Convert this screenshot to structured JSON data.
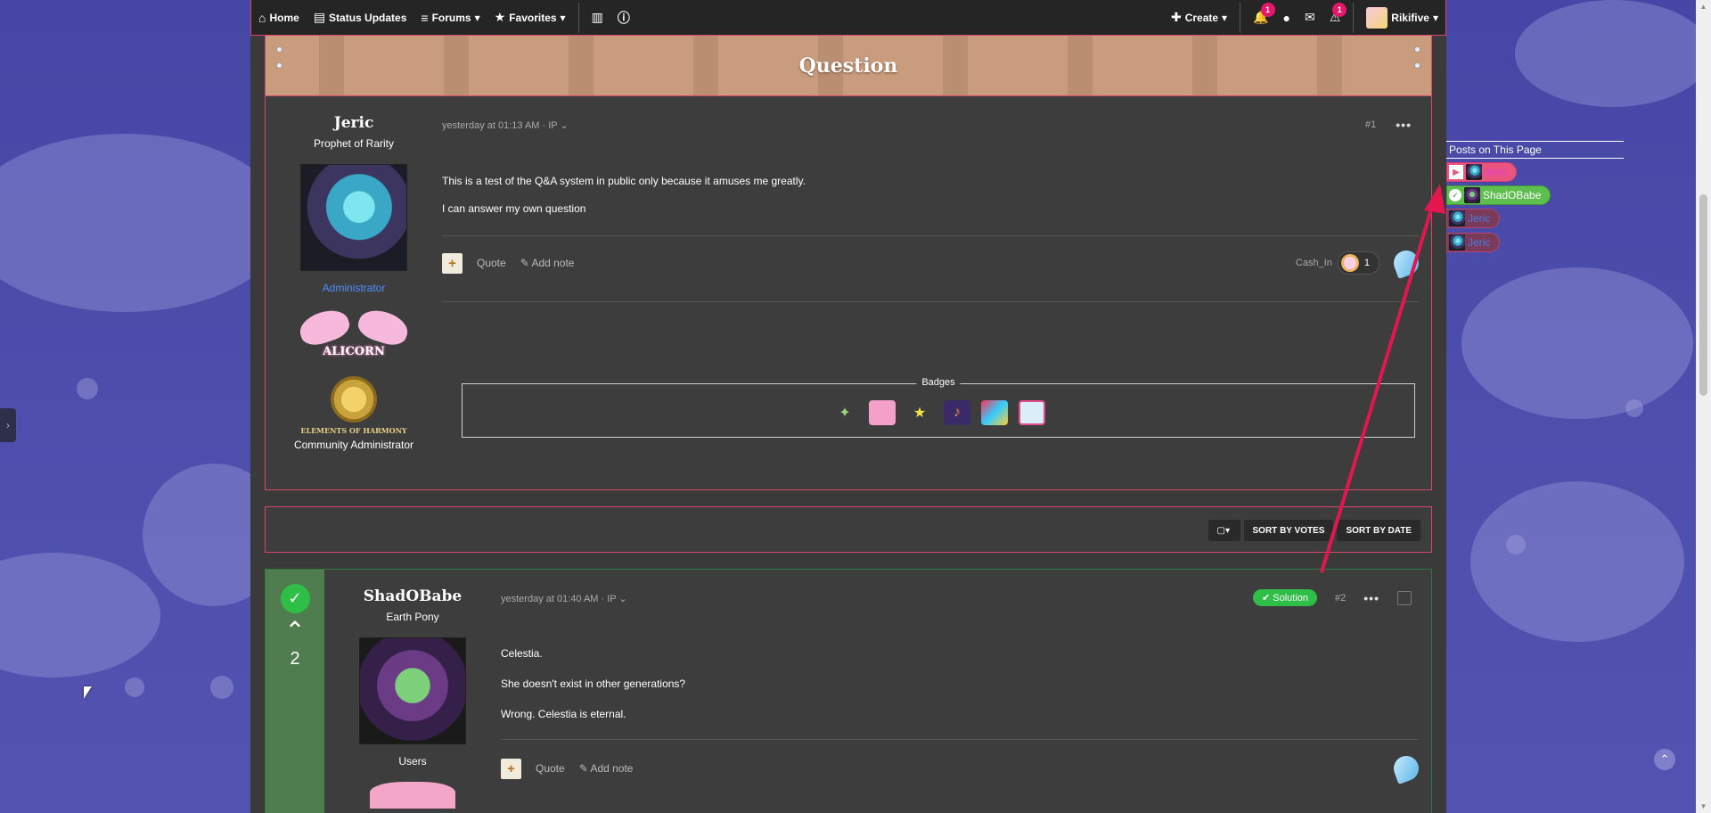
{
  "nav": {
    "home": "Home",
    "status_updates": "Status Updates",
    "forums": "Forums",
    "favorites": "Favorites",
    "create": "Create",
    "alerts_count": "1",
    "warnings_count": "1",
    "username": "Rikifive",
    "icons": [
      "home-icon",
      "status-icon",
      "menu-icon",
      "star-icon",
      "book-icon",
      "help-icon",
      "plus-icon",
      "bell-icon",
      "user-icon",
      "envelope-icon",
      "warning-icon"
    ]
  },
  "banner": {
    "title": "Question"
  },
  "post1": {
    "username": "Jeric",
    "user_title": "Prophet of Rarity",
    "role": "Administrator",
    "alicorn_text": "ALICORN",
    "elements_text": "ELEMENTS OF HARMONY",
    "community_role": "Community Administrator",
    "meta": "yesterday at 01:13 AM · IP",
    "post_number": "#1",
    "paragraphs": [
      "This is a test of the Q&A system in public only because it amuses me greatly.",
      "I can answer my own question"
    ],
    "quote": "Quote",
    "add_note": "Add note",
    "reactor_name": "Cash_In",
    "reaction_count": "1",
    "badges_legend": "Badges"
  },
  "sortbar": {
    "sort_votes": "SORT BY VOTES",
    "sort_date": "SORT BY DATE"
  },
  "post2": {
    "vote_count": "2",
    "username": "ShadOBabe",
    "user_title": "Earth Pony",
    "group": "Users",
    "meta": "yesterday at 01:40 AM · IP",
    "solution_label": "Solution",
    "post_number": "#2",
    "paragraphs": [
      "Celestia.",
      "She doesn't exist in other generations?",
      "Wrong. Celestia is eternal."
    ],
    "quote": "Quote",
    "add_note": "Add note"
  },
  "posts_on_page": {
    "header": "Posts on This Page",
    "items": [
      "Jeric",
      "ShadOBabe",
      "Jeric",
      "Jeric"
    ]
  },
  "colors": {
    "accent_border": "#d9486b",
    "solution_green": "#2fbf47",
    "admin_blue": "#4f8dff",
    "annotation_red": "#e3174f"
  }
}
